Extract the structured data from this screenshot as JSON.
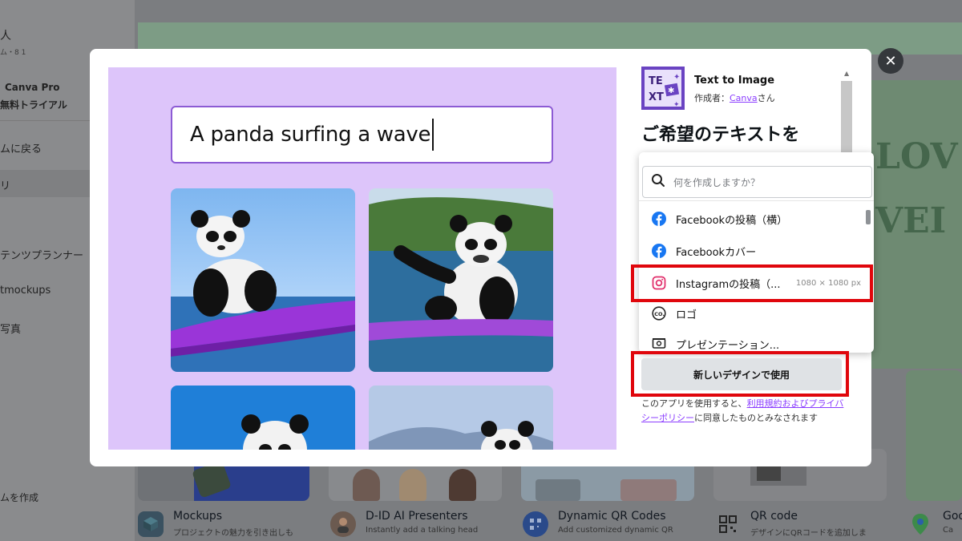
{
  "background": {
    "sidebar": {
      "top_label": "人",
      "top_sub": "ム・8 1",
      "pro_line1": "Canva Pro",
      "pro_line2": "無料トライアル",
      "back": "ムに戻る",
      "active_item": "リ",
      "planner": "テンツプランナー",
      "mockups": "tmockups",
      "photos": "写真",
      "create_team": "ムを作成"
    },
    "apps": [
      {
        "title": "Mockups",
        "desc": "プロジェクトの魅力を引き出しも"
      },
      {
        "title": "D-ID AI Presenters",
        "desc": "Instantly add a talking head"
      },
      {
        "title": "Dynamic QR Codes",
        "desc": "Add customized dynamic QR"
      },
      {
        "title": "QR code",
        "desc": "デザインにQRコードを追加しま"
      },
      {
        "title": "Goo",
        "desc": "Ca"
      }
    ],
    "right_text": [
      "LOV",
      "VEI"
    ]
  },
  "modal": {
    "close_label": "✕",
    "prompt": "A panda surfing a wave",
    "app_logo_text": "TEXT",
    "app_name": "Text to Image",
    "author_prefix": "作成者：",
    "author_name": "Canva",
    "author_suffix": "さん",
    "heading": "ご希望のテキストを",
    "search_placeholder": "何を作成しますか？",
    "dropdown_items": [
      {
        "label": "Facebookの投稿（横）",
        "icon": "facebook-icon",
        "size": ""
      },
      {
        "label": "Facebookカバー",
        "icon": "facebook-icon",
        "size": ""
      },
      {
        "label": "Instagramの投稿（...",
        "icon": "instagram-icon",
        "size": "1080 × 1080 px"
      },
      {
        "label": "ロゴ",
        "icon": "logo-icon",
        "size": ""
      },
      {
        "label": "プレゼンテーション...",
        "icon": "presentation-icon",
        "size": ""
      }
    ],
    "use_button": "新しいデザインで使用",
    "terms_before": "このアプリを使用すると、",
    "terms_link": "利用規約およびプライバシーポリシー",
    "terms_after": "に同意したものとみなされます"
  },
  "colors": {
    "accent": "#8b3dff",
    "highlight": "#e0060c",
    "preview_bg": "#ddc5fa",
    "facebook": "#1877f2",
    "instagram": "#e1306c"
  }
}
